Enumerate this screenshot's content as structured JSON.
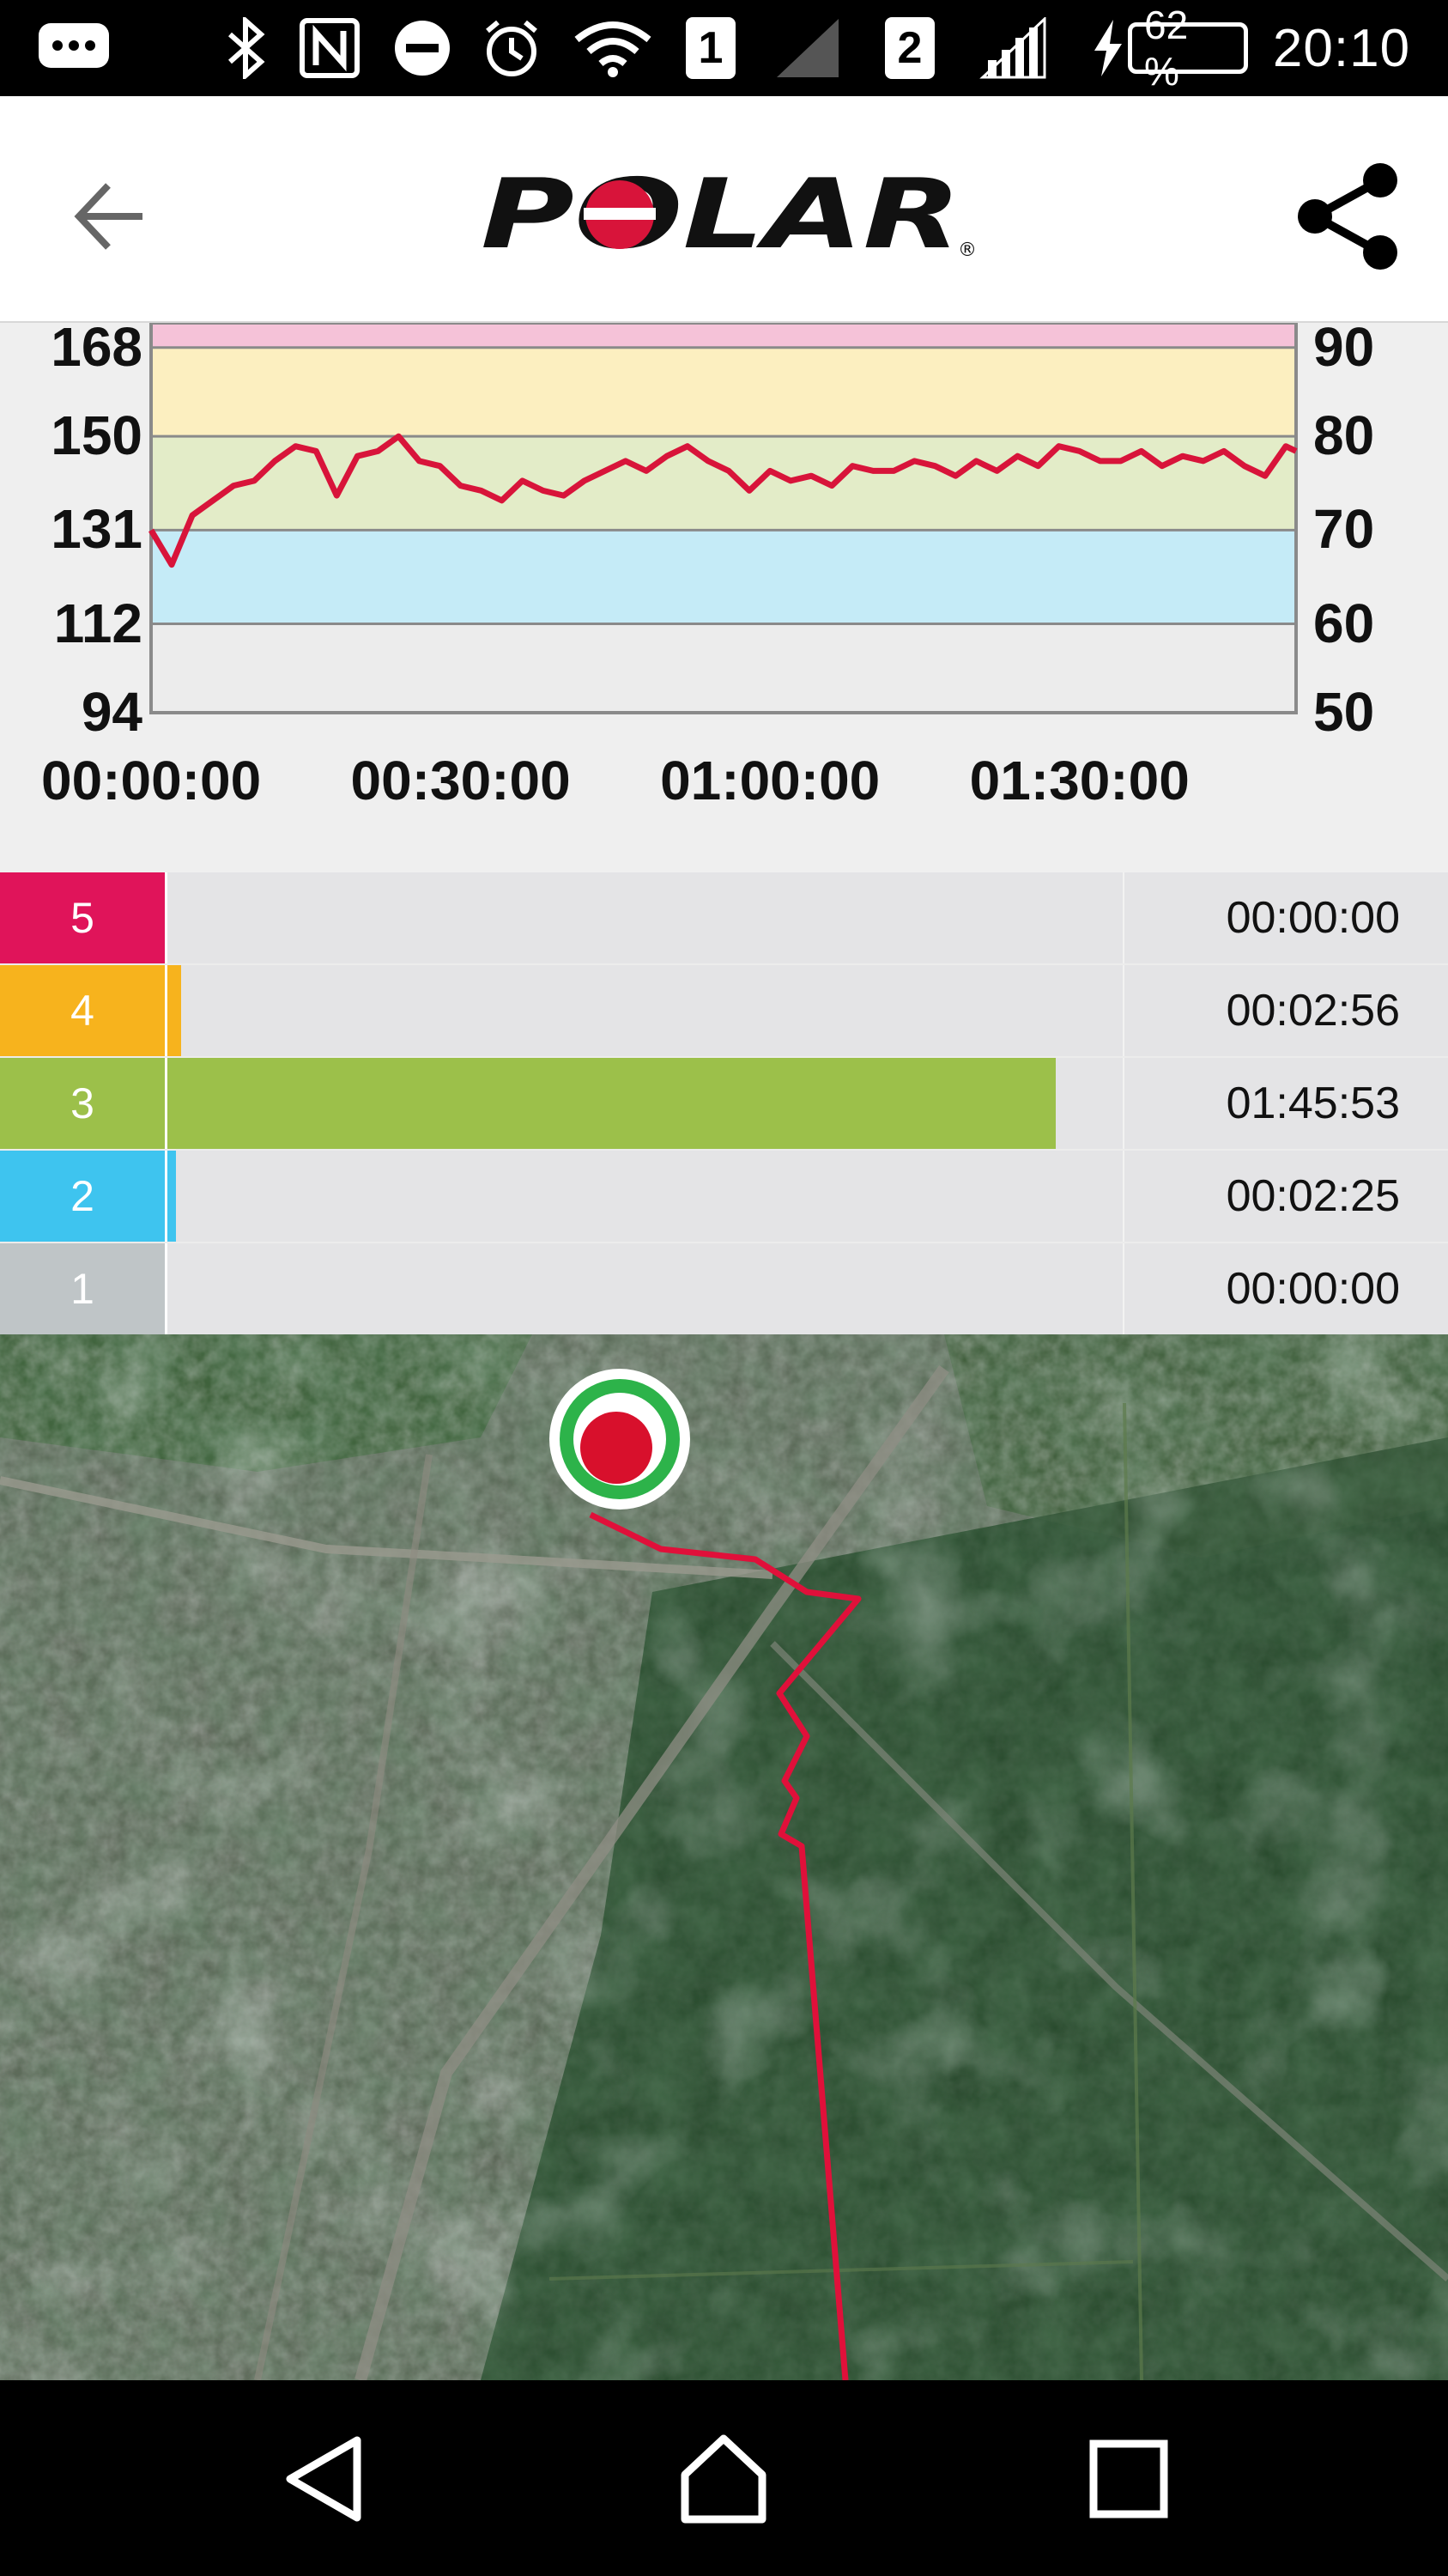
{
  "status_bar": {
    "sim1": "1",
    "sim2": "2",
    "battery": "62 %",
    "time": "20:10",
    "icons": [
      "chat-icon",
      "bluetooth-icon",
      "nfc-icon",
      "do-not-disturb-icon",
      "alarm-icon",
      "wifi-icon",
      "signal-icon",
      "signal-icon",
      "charging-icon",
      "battery-icon"
    ]
  },
  "app_bar": {
    "brand": "POLAR",
    "icons": [
      "back-arrow-icon",
      "share-icon"
    ]
  },
  "chart_data": {
    "type": "line",
    "y_left_ticks": [
      "168",
      "150",
      "131",
      "112",
      "94"
    ],
    "y_right_ticks": [
      "90",
      "80",
      "70",
      "60",
      "50"
    ],
    "x_ticks": [
      "00:00:00",
      "00:30:00",
      "01:00:00",
      "01:30:00"
    ],
    "ylim": [
      94,
      173
    ],
    "xlim_minutes": [
      0,
      111
    ],
    "zone_bands": [
      {
        "from": 150,
        "to": 168,
        "color": "#fcefc0"
      },
      {
        "from": 131,
        "to": 150,
        "color": "#e3ecc8"
      },
      {
        "from": 112,
        "to": 131,
        "color": "#c5ebf7"
      },
      {
        "from": 94,
        "to": 112,
        "color": "#ececec"
      },
      {
        "from": 168,
        "to": 173,
        "color": "#f5c2d8"
      }
    ],
    "series_color": "#d8143a",
    "x_minutes": [
      0,
      2,
      4,
      6,
      8,
      10,
      12,
      14,
      16,
      18,
      20,
      22,
      24,
      26,
      28,
      30,
      32,
      34,
      36,
      38,
      40,
      42,
      44,
      46,
      48,
      50,
      52,
      54,
      56,
      58,
      60,
      62,
      64,
      66,
      68,
      70,
      72,
      74,
      76,
      78,
      80,
      82,
      84,
      86,
      88,
      90,
      92,
      94,
      96,
      98,
      100,
      102,
      104,
      106,
      108,
      110,
      111
    ],
    "values": [
      131,
      124,
      134,
      137,
      140,
      141,
      145,
      148,
      147,
      138,
      146,
      147,
      150,
      145,
      144,
      140,
      139,
      137,
      141,
      139,
      138,
      141,
      143,
      145,
      143,
      146,
      148,
      145,
      143,
      139,
      143,
      141,
      142,
      140,
      144,
      143,
      143,
      145,
      144,
      142,
      145,
      143,
      146,
      144,
      148,
      147,
      145,
      145,
      147,
      144,
      146,
      145,
      147,
      144,
      142,
      148,
      147
    ]
  },
  "zones": [
    {
      "number": "5",
      "color": "#e0145a",
      "fill_fraction": 0.0,
      "time": "00:00:00"
    },
    {
      "number": "4",
      "color": "#f7b31d",
      "fill_fraction": 0.017,
      "time": "00:02:56"
    },
    {
      "number": "3",
      "color": "#9cc04a",
      "fill_fraction": 0.93,
      "time": "01:45:53"
    },
    {
      "number": "2",
      "color": "#3ec4ef",
      "fill_fraction": 0.012,
      "time": "00:02:25"
    },
    {
      "number": "1",
      "color": "#bfc5c7",
      "fill_fraction": 0.0,
      "time": "00:00:00"
    }
  ],
  "map": {
    "route_color": "#e0103a",
    "start_marker": "start-marker"
  },
  "nav_bar": {
    "icons": [
      "back-nav-icon",
      "home-nav-icon",
      "recents-nav-icon"
    ]
  }
}
